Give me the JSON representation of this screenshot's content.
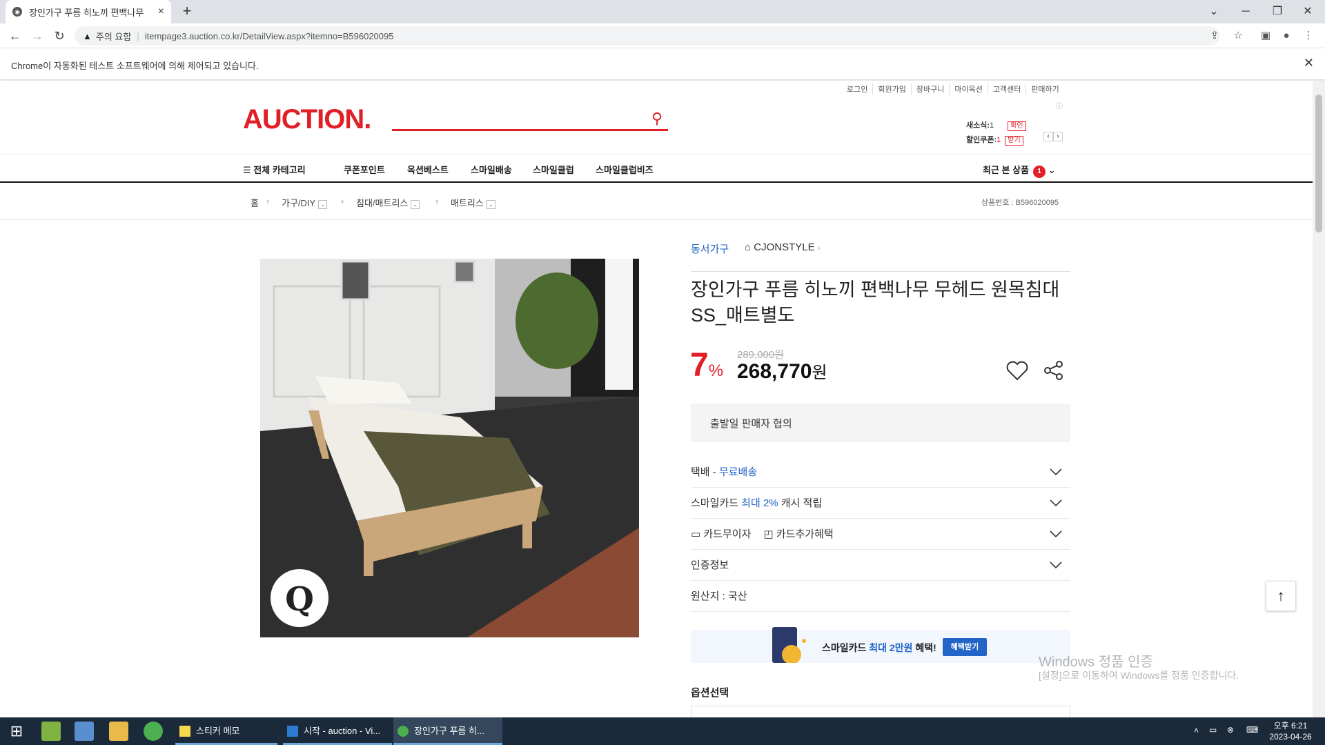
{
  "browser": {
    "tab_title": "장인가구 푸름 히노끼 편백나무",
    "security_warning": "주의 요함",
    "url": "itempage3.auction.co.kr/DetailView.aspx?itemno=B596020095",
    "infobar_message": "Chrome이 자동화된 테스트 소프트웨어에 의해 제어되고 있습니다."
  },
  "header": {
    "util_nav": [
      "로그인",
      "회원가입",
      "장바구니",
      "마이옥션",
      "고객센터",
      "판매하기"
    ],
    "logo_text": "AUCTION.",
    "coupons": {
      "new_news_label": "새소식:",
      "new_news_count": "1",
      "new_news_btn": "확인",
      "coupon_label": "할인쿠폰:",
      "coupon_count": "1",
      "coupon_btn": "받기"
    }
  },
  "gnb": {
    "all_category": "전체 카테고리",
    "menus": [
      "쿠폰포인트",
      "옥션베스트",
      "스마일배송",
      "스마일클럽",
      "스마일클럽비즈"
    ],
    "recent_label": "최근 본 상품",
    "recent_count": "1"
  },
  "breadcrumb": {
    "items": [
      "홈",
      "가구/DIY",
      "침대/매트리스",
      "매트리스"
    ],
    "product_number": "상품번호 : B596020095"
  },
  "product": {
    "seller": "동서가구",
    "store": "CJONSTYLE",
    "title": "장인가구 푸름 히노끼 편백나무 무헤드 원목침대 SS_매트별도",
    "discount_rate": "7",
    "discount_unit": "%",
    "original_price": "289,000원",
    "sale_price": "268,770",
    "sale_price_unit": "원",
    "ship_date": "출발일 판매자 협의",
    "delivery_label": "택배 - ",
    "delivery_value": "무료배송",
    "smilecard_label": "스마일카드 ",
    "smilecard_value": "최대 2%",
    "smilecard_suffix": " 캐시 적립",
    "card_interest_free": "카드무이자",
    "card_benefit": "카드추가혜택",
    "certification": "인증정보",
    "origin": "원산지 : 국산",
    "banner_text_1": "스마일카드 ",
    "banner_text_blue": "최대 2만원",
    "banner_text_2": " 혜택!",
    "banner_button": "혜택받기",
    "option_title": "옵션선택"
  },
  "watermark": {
    "line1": "Windows 정품 인증",
    "line2": "[설정]으로 이동하여 Windows를 정품 인증합니다."
  },
  "taskbar": {
    "apps": [
      "스티커 메모",
      "시작 - auction - Vi...",
      "장인가구 푸름 히..."
    ],
    "time_period": "오후 6:21",
    "date": "2023-04-26"
  },
  "colors": {
    "brand_red": "#e01f26",
    "link_blue": "#2264c8"
  }
}
